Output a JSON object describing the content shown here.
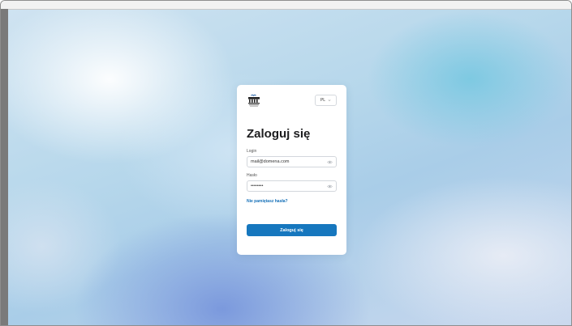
{
  "colors": {
    "accent": "#1677be",
    "link": "#1570b8",
    "card_bg": "#ffffff"
  },
  "login_card": {
    "logo_icon": "organization-logo-icon",
    "language": {
      "selected": "PL",
      "icon": "chevron-down-icon"
    },
    "title": "Zaloguj się",
    "login": {
      "label": "Login",
      "value": "mail@domena.com",
      "icon": "eye-icon"
    },
    "password": {
      "label": "Hasło",
      "value": "••••••••",
      "icon": "eye-icon"
    },
    "forgot_link": "Nie pamiętasz hasła?",
    "submit_label": "Zaloguj się"
  }
}
